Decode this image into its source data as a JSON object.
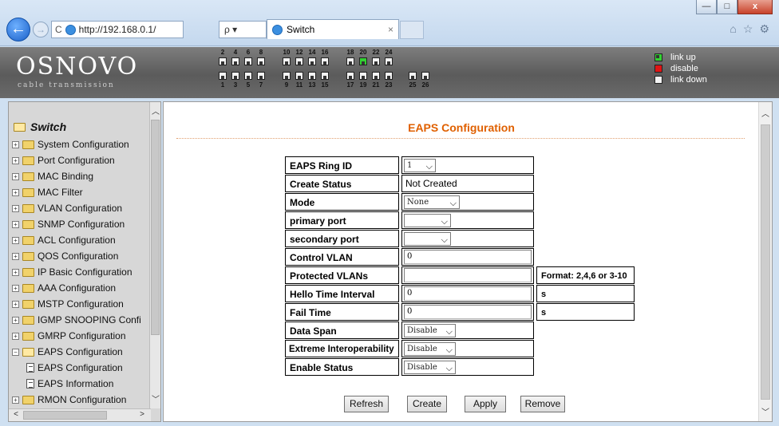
{
  "browser": {
    "url": "http://192.168.0.1/",
    "search_glyph": "ρ ▾",
    "tab_title": "Switch",
    "tab_close": "×",
    "win_min": "—",
    "win_max": "□",
    "win_close": "x",
    "back_glyph": "←",
    "fwd_glyph": "→",
    "refresh_glyph": "C",
    "toolbar_icons": [
      "⌂",
      "☆",
      "⚙"
    ]
  },
  "device": {
    "logo": "OSNOVO",
    "logo_sub": "cable transmission",
    "ports_top": [
      "2",
      "4",
      "6",
      "8",
      "10",
      "12",
      "14",
      "16",
      "18",
      "20",
      "22",
      "24"
    ],
    "ports_bottom": [
      "1",
      "3",
      "5",
      "7",
      "9",
      "11",
      "13",
      "15",
      "17",
      "19",
      "21",
      "23",
      "25",
      "26"
    ],
    "legend": [
      {
        "label": "link up",
        "state": "up"
      },
      {
        "label": "disable",
        "state": "dis"
      },
      {
        "label": "link down",
        "state": "down"
      }
    ]
  },
  "sidebar": {
    "root": "Switch",
    "items": [
      {
        "label": "System Configuration",
        "kind": "folder"
      },
      {
        "label": "Port Configuration",
        "kind": "folder"
      },
      {
        "label": "MAC Binding",
        "kind": "folder"
      },
      {
        "label": "MAC Filter",
        "kind": "folder"
      },
      {
        "label": "VLAN Configuration",
        "kind": "folder"
      },
      {
        "label": "SNMP Configuration",
        "kind": "folder"
      },
      {
        "label": "ACL Configuration",
        "kind": "folder"
      },
      {
        "label": "QOS Configuration",
        "kind": "folder"
      },
      {
        "label": "IP Basic Configuration",
        "kind": "folder"
      },
      {
        "label": "AAA Configuration",
        "kind": "folder"
      },
      {
        "label": "MSTP Configuration",
        "kind": "folder"
      },
      {
        "label": "IGMP SNOOPING Confi",
        "kind": "folder"
      },
      {
        "label": "GMRP Configuration",
        "kind": "folder"
      },
      {
        "label": "EAPS Configuration",
        "kind": "folder-open"
      },
      {
        "label": "EAPS Configuration",
        "kind": "page"
      },
      {
        "label": "EAPS Information",
        "kind": "page"
      },
      {
        "label": "RMON Configuration",
        "kind": "folder"
      }
    ]
  },
  "main": {
    "title": "EAPS Configuration",
    "fields": {
      "ring_id": {
        "label": "EAPS Ring ID",
        "value": "1"
      },
      "create_status": {
        "label": "Create Status",
        "value": "Not Created"
      },
      "mode": {
        "label": "Mode",
        "value": "None"
      },
      "primary_port": {
        "label": "primary port",
        "value": ""
      },
      "secondary_port": {
        "label": "secondary port",
        "value": ""
      },
      "control_vlan": {
        "label": "Control VLAN",
        "value": "0"
      },
      "protected_vlans": {
        "label": "Protected VLANs",
        "value": "",
        "note": "Format: 2,4,6 or 3-10"
      },
      "hello_time": {
        "label": "Hello Time Interval",
        "value": "0",
        "unit": "s"
      },
      "fail_time": {
        "label": "Fail Time",
        "value": "0",
        "unit": "s"
      },
      "data_span": {
        "label": "Data Span",
        "value": "Disable"
      },
      "extreme_interop": {
        "label": "Extreme Interoperability",
        "value": "Disable"
      },
      "enable_status": {
        "label": "Enable Status",
        "value": "Disable"
      }
    },
    "buttons": {
      "refresh": "Refresh",
      "create": "Create",
      "apply": "Apply",
      "remove": "Remove"
    }
  }
}
